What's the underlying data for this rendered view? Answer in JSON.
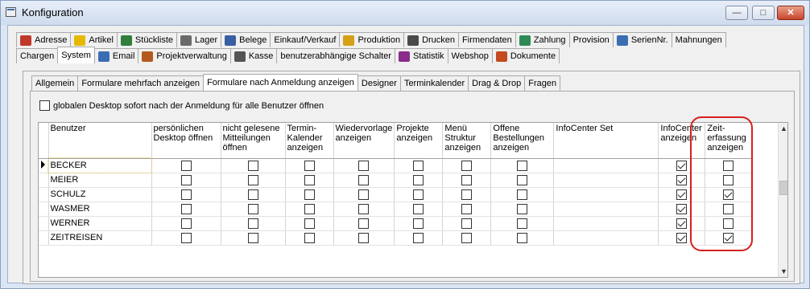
{
  "window": {
    "title": "Konfiguration"
  },
  "main_tabs_row1": [
    {
      "label": "Adresse",
      "icon": "person-icon",
      "color": "#c0392b"
    },
    {
      "label": "Artikel",
      "icon": "article-icon",
      "color": "#e6b800"
    },
    {
      "label": "Stückliste",
      "icon": "list-icon",
      "color": "#2f7f3a"
    },
    {
      "label": "Lager",
      "icon": "warehouse-icon",
      "color": "#6a6a6a"
    },
    {
      "label": "Belege",
      "icon": "document-icon",
      "color": "#3a5fa0"
    },
    {
      "label": "Einkauf/Verkauf",
      "icon": "",
      "color": ""
    },
    {
      "label": "Produktion",
      "icon": "production-icon",
      "color": "#d4a017"
    },
    {
      "label": "Drucken",
      "icon": "printer-icon",
      "color": "#4a4a4a"
    },
    {
      "label": "Firmendaten",
      "icon": "",
      "color": ""
    },
    {
      "label": "Zahlung",
      "icon": "money-icon",
      "color": "#2e8b57"
    },
    {
      "label": "Provision",
      "icon": "",
      "color": ""
    },
    {
      "label": "SerienNr.",
      "icon": "serial-icon",
      "color": "#3b6db3"
    },
    {
      "label": "Mahnungen",
      "icon": "",
      "color": ""
    }
  ],
  "main_tabs_row2": [
    {
      "label": "Chargen",
      "icon": "",
      "color": ""
    },
    {
      "label": "System",
      "icon": "",
      "color": "",
      "active": true
    },
    {
      "label": "Email",
      "icon": "email-icon",
      "color": "#3b6db3"
    },
    {
      "label": "Projektverwaltung",
      "icon": "project-icon",
      "color": "#b35a1f"
    },
    {
      "label": "Kasse",
      "icon": "register-icon",
      "color": "#555555"
    },
    {
      "label": "benutzerabhängige Schalter",
      "icon": "",
      "color": ""
    },
    {
      "label": "Statistik",
      "icon": "chart-icon",
      "color": "#8a2c8a"
    },
    {
      "label": "Webshop",
      "icon": "",
      "color": ""
    },
    {
      "label": "Dokumente",
      "icon": "documents-icon",
      "color": "#c44a1f"
    }
  ],
  "sub_tabs": [
    {
      "label": "Allgemein"
    },
    {
      "label": "Formulare mehrfach anzeigen"
    },
    {
      "label": "Formulare nach Anmeldung anzeigen",
      "active": true
    },
    {
      "label": "Designer"
    },
    {
      "label": "Terminkalender"
    },
    {
      "label": "Drag & Drop"
    },
    {
      "label": "Fragen"
    }
  ],
  "global_option": {
    "label": "globalen Desktop sofort nach der Anmeldung für alle Benutzer öffnen",
    "checked": false
  },
  "grid": {
    "columns": [
      {
        "key": "user",
        "lines": [
          "Benutzer"
        ]
      },
      {
        "key": "desktop",
        "lines": [
          "persönlichen",
          "Desktop öffnen"
        ]
      },
      {
        "key": "mitteilungen",
        "lines": [
          "nicht gelesene",
          "Mitteilungen",
          "öffnen"
        ]
      },
      {
        "key": "termin",
        "lines": [
          "Termin-",
          "Kalender",
          "anzeigen"
        ]
      },
      {
        "key": "wiedervorlage",
        "lines": [
          "Wiedervorlage",
          "anzeigen"
        ]
      },
      {
        "key": "projekte",
        "lines": [
          "Projekte",
          "anzeigen"
        ]
      },
      {
        "key": "menue",
        "lines": [
          "Menü",
          "Struktur",
          "anzeigen"
        ]
      },
      {
        "key": "bestellungen",
        "lines": [
          "Offene",
          "Bestellungen",
          "anzeigen"
        ]
      },
      {
        "key": "infocenterset",
        "lines": [
          "InfoCenter Set"
        ]
      },
      {
        "key": "infocenter",
        "lines": [
          "InfoCenter",
          "anzeigen"
        ]
      },
      {
        "key": "zeiterfassung",
        "lines": [
          "Zeit-",
          "erfassung",
          "anzeigen"
        ]
      }
    ],
    "rows": [
      {
        "user": "BECKER",
        "current": true,
        "desktop": false,
        "mitteilungen": false,
        "termin": false,
        "wiedervorlage": false,
        "projekte": false,
        "menue": false,
        "bestellungen": false,
        "infocenter": true,
        "zeiterfassung": false
      },
      {
        "user": "MEIER",
        "desktop": false,
        "mitteilungen": false,
        "termin": false,
        "wiedervorlage": false,
        "projekte": false,
        "menue": false,
        "bestellungen": false,
        "infocenter": true,
        "zeiterfassung": false
      },
      {
        "user": "SCHULZ",
        "desktop": false,
        "mitteilungen": false,
        "termin": false,
        "wiedervorlage": false,
        "projekte": false,
        "menue": false,
        "bestellungen": false,
        "infocenter": true,
        "zeiterfassung": true
      },
      {
        "user": "WASMER",
        "desktop": false,
        "mitteilungen": false,
        "termin": false,
        "wiedervorlage": false,
        "projekte": false,
        "menue": false,
        "bestellungen": false,
        "infocenter": true,
        "zeiterfassung": false
      },
      {
        "user": "WERNER",
        "desktop": false,
        "mitteilungen": false,
        "termin": false,
        "wiedervorlage": false,
        "projekte": false,
        "menue": false,
        "bestellungen": false,
        "infocenter": true,
        "zeiterfassung": false
      },
      {
        "user": "ZEITREISEN",
        "desktop": false,
        "mitteilungen": false,
        "termin": false,
        "wiedervorlage": false,
        "projekte": false,
        "menue": false,
        "bestellungen": false,
        "infocenter": true,
        "zeiterfassung": true
      }
    ]
  },
  "accent": {
    "highlight": "#d71f1f"
  }
}
